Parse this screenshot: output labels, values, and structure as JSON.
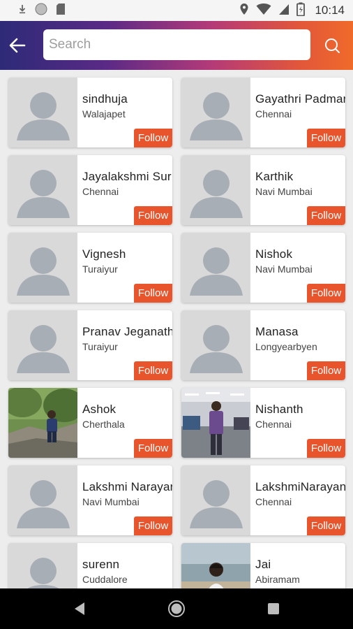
{
  "status_bar": {
    "time": "10:14",
    "icons": [
      "download-icon",
      "circle-icon",
      "sd-card-icon",
      "location-icon",
      "wifi-icon",
      "signal-icon",
      "battery-icon"
    ]
  },
  "toolbar": {
    "search_placeholder": "Search",
    "search_value": "",
    "back_icon": "arrow-left-icon",
    "search_icon": "search-icon",
    "gradient_colors": [
      "#2d2a78",
      "#b43a78",
      "#f06a2a"
    ]
  },
  "follow_label": "Follow",
  "accent_color": "#e8542b",
  "users": [
    {
      "name": "sindhuja",
      "city": "Walajapet",
      "photo": "placeholder"
    },
    {
      "name": "Gayathri Padmar",
      "city": "Chennai",
      "photo": "placeholder"
    },
    {
      "name": "Jayalakshmi Sur",
      "city": "Chennai",
      "photo": "placeholder"
    },
    {
      "name": "Karthik",
      "city": "Navi Mumbai",
      "photo": "placeholder"
    },
    {
      "name": "Vignesh",
      "city": "Turaiyur",
      "photo": "placeholder"
    },
    {
      "name": "Nishok",
      "city": "Navi Mumbai",
      "photo": "placeholder"
    },
    {
      "name": "Pranav Jeganath",
      "city": "Turaiyur",
      "photo": "placeholder"
    },
    {
      "name": "Manasa",
      "city": "Longyearbyen",
      "photo": "placeholder"
    },
    {
      "name": "Ashok",
      "city": "Cherthala",
      "photo": "outdoor-photo"
    },
    {
      "name": "Nishanth",
      "city": "Chennai",
      "photo": "office-photo"
    },
    {
      "name": "Lakshmi Narayar",
      "city": "Navi Mumbai",
      "photo": "placeholder"
    },
    {
      "name": "LakshmiNarayan",
      "city": "Chennai",
      "photo": "placeholder"
    },
    {
      "name": "surenn",
      "city": "Cuddalore",
      "photo": "placeholder"
    },
    {
      "name": "Jai",
      "city": "Abiramam",
      "photo": "beach-photo"
    }
  ],
  "nav_bar": {
    "buttons": [
      "back-triangle-icon",
      "home-circle-icon",
      "recents-square-icon"
    ]
  }
}
